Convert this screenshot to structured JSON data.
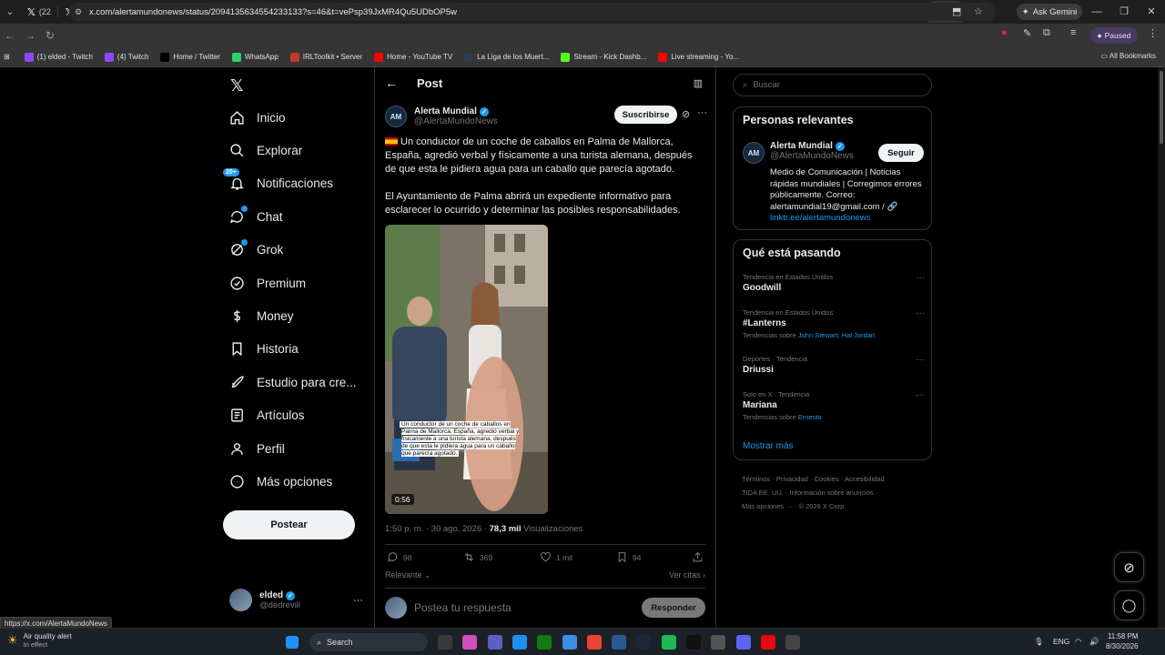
{
  "browser": {
    "tab_label": "(22",
    "tab_count": 25,
    "gemini_label": "Ask Gemini",
    "url": "x.com/alertamundonews/status/2094135634554233133?s=46&t=vePsp39JxMR4Qu5UDbOP5w",
    "profile_status": "Paused",
    "bookmarks": [
      {
        "label": "(1) elded - Twitch",
        "color": "#9146ff"
      },
      {
        "label": "(4) Twitch",
        "color": "#9146ff"
      },
      {
        "label": "Home / Twitter",
        "color": "#000000"
      },
      {
        "label": "WhatsApp",
        "color": "#25d366"
      },
      {
        "label": "IRLToolkit • Server",
        "color": "#c0392b"
      },
      {
        "label": "Home - YouTube TV",
        "color": "#ff0000"
      },
      {
        "label": "La Liga de los Muert...",
        "color": "#2c3e50"
      },
      {
        "label": "Stream - Kick Dashb...",
        "color": "#53fc18"
      },
      {
        "label": "Live streaming - Yo...",
        "color": "#ff0000"
      }
    ],
    "all_bookmarks": "All Bookmarks",
    "status_url": "https://x.com/AlertaMundoNews"
  },
  "nav": {
    "items": [
      {
        "label": "Inicio",
        "icon": "home-icon"
      },
      {
        "label": "Explorar",
        "icon": "search-icon"
      },
      {
        "label": "Notificaciones",
        "icon": "bell-icon",
        "badge": "20+"
      },
      {
        "label": "Chat",
        "icon": "chat-icon"
      },
      {
        "label": "Grok",
        "icon": "grok-icon"
      },
      {
        "label": "Premium",
        "icon": "premium-icon"
      },
      {
        "label": "Money",
        "icon": "money-icon"
      },
      {
        "label": "Historia",
        "icon": "bookmark-icon"
      },
      {
        "label": "Estudio para cre...",
        "icon": "rocket-icon"
      },
      {
        "label": "Artículos",
        "icon": "article-icon"
      },
      {
        "label": "Perfil",
        "icon": "person-icon"
      },
      {
        "label": "Más opciones",
        "icon": "more-circle-icon"
      }
    ],
    "post_button": "Postear",
    "user": {
      "name": "elded",
      "handle": "@dedrevill"
    }
  },
  "post": {
    "header_title": "Post",
    "author_name": "Alerta Mundial",
    "author_handle": "@AlertaMundoNews",
    "subscribe_label": "Suscribirse",
    "paragraph1": "Un conductor de un coche de caballos en Palma de Mallorca, España, agredió verbal y físicamente a una turista alemana, después de que esta le pidiera agua para un caballo que parecía agotado.",
    "paragraph2": "El Ayuntamiento de Palma abrirá un expediente informativo para esclarecer lo ocurrido y determinar las posibles responsabilidades.",
    "video_caption": "Un conductor de un coche de caballos en Palma de Mallorca, España, agredió verbal y físicamente a una turista alemana, después de que esta le pidiera agua para un caballo que parecía agotado.",
    "video_duration": "0:56",
    "time": "1:50 p. m. · 30 ago. 2026 · ",
    "views": "78,3 mil",
    "views_label": " Visualizaciones",
    "replies": "98",
    "reposts": "369",
    "likes": "1 mil",
    "bookmarks": "94",
    "sort_label": "Relevante",
    "quotes_label": "Ver citas",
    "reply_placeholder": "Postea tu respuesta",
    "reply_button": "Responder"
  },
  "right": {
    "search_placeholder": "Buscar",
    "relevant_title": "Personas relevantes",
    "rel_name": "Alerta Mundial",
    "rel_handle": "@AlertaMundoNews",
    "follow_label": "Seguir",
    "rel_bio": "Medio de Comunicación | Noticias rápidas mundiales | Corregimos errores públicamente. Correo: alertamundial19@gmail.com /",
    "rel_link": "linktr.ee/alertamundonews",
    "trending_title": "Qué está pasando",
    "trends": [
      {
        "category": "Tendencia en Estados Unidos",
        "title": "Goodwill",
        "sub_prefix": "",
        "sub_links": ""
      },
      {
        "category": "Tendencia en Estados Unidos",
        "title": "#Lanterns",
        "sub_prefix": "Tendencias sobre ",
        "sub_links": "John Stewart, Hal Jordan"
      },
      {
        "category": "Deportes · Tendencia",
        "title": "Driussi",
        "sub_prefix": "",
        "sub_links": ""
      },
      {
        "category": "Solo en X · Tendencia",
        "title": "Mariana",
        "sub_prefix": "Tendencias sobre ",
        "sub_links": "Ernesto"
      }
    ],
    "show_more": "Mostrar más",
    "footer1": "Términos · Privacidad · Cookies · Accesibilidad ·",
    "footer2": "TIDA EE. UU. · Información sobre anuncios ·",
    "footer3": "Más opciones ··· · © 2026 X Corp."
  },
  "taskbar": {
    "aqi_title": "Air quality alert",
    "aqi_sub": "In effect",
    "search_label": "Search",
    "lang": "ENG",
    "time": "11:58 PM",
    "date": "8/30/2026"
  },
  "colors": {
    "accent": "#1d9bf0",
    "background": "#000000",
    "border": "#2f3336"
  }
}
